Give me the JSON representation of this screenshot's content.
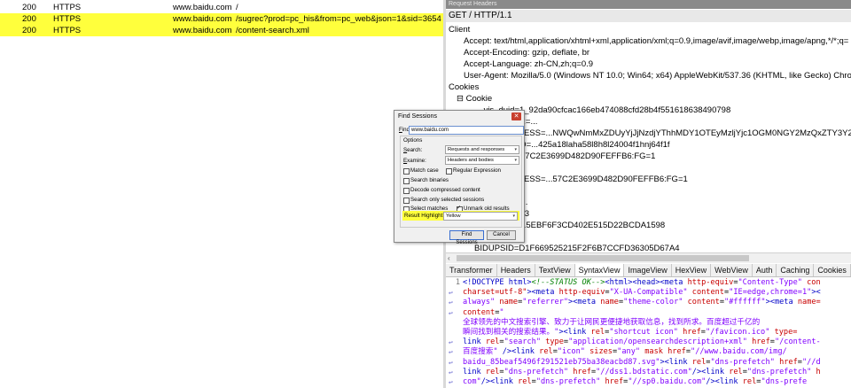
{
  "sessions": [
    {
      "result": "200",
      "protocol": "HTTPS",
      "host": "www.baidu.com",
      "url": "/",
      "highlight": false
    },
    {
      "result": "200",
      "protocol": "HTTPS",
      "host": "www.baidu.com",
      "url": "/sugrec?prod=pc_his&from=pc_web&json=1&sid=3654",
      "highlight": true
    },
    {
      "result": "200",
      "protocol": "HTTPS",
      "host": "www.baidu.com",
      "url": "/content-search.xml",
      "highlight": true
    }
  ],
  "inspector": {
    "caption": "Request Headers",
    "request_line": "GET / HTTP/1.1",
    "headers": [
      {
        "cls": "g",
        "text": "Client"
      },
      {
        "cls": "h2",
        "text": "Accept: text/html,application/xhtml+xml,application/xml;q=0.9,image/avif,image/webp,image/apng,*/*;q="
      },
      {
        "cls": "h2",
        "text": "Accept-Encoding: gzip, deflate, br"
      },
      {
        "cls": "h2",
        "text": "Accept-Language: zh-CN,zh;q=0.9"
      },
      {
        "cls": "h2",
        "text": "User-Agent: Mozilla/5.0 (Windows NT 10.0; Win64; x64) AppleWebKit/537.36 (KHTML, like Gecko) Chrome/"
      },
      {
        "cls": "g",
        "text": "Cookies"
      },
      {
        "cls": "h1",
        "text": "⊟ Cookie"
      },
      {
        "cls": "h3",
        "text": "__yjs_duid=1_92da90cfcac166eb474088cfd28b4f551618638490798"
      },
      {
        "cls": "h3",
        "text": "BA_HECTOR=..."
      },
      {
        "cls": "h3",
        "text": "BAIDUID_BFESS=...NWQwNmMxZDUyYjJjNzdjYThhMDY1OTEyMzljYjc1OGM0NGY2MzQxZTY3Y2UzZmY4NTlmN"
      },
      {
        "cls": "h3",
        "text": "H_PS_PSSID=...425a18laha58l8h8l24004f1hnj64f1f"
      },
      {
        "cls": "h3",
        "text": "BAIDUID=...57C2E3699D482D90FEFFB6:FG=1"
      },
      {
        "cls": "h3",
        "text": "BDORZ=...5"
      },
      {
        "cls": "h3",
        "text": "BAIDUID_BFESS=...57C2E3699D482D90FEFFB6:FG=1"
      },
      {
        "cls": "h3",
        "text": "BD_UPN=..."
      },
      {
        "cls": "h3",
        "text": "BD_HOME=..."
      },
      {
        "cls": "h3",
        "text": "delPer=...4753"
      },
      {
        "cls": "h3",
        "text": "BIDUPSID=...5EBF6F3CD402E515D22BCDA1598"
      },
      {
        "cls": "h3",
        "text": "BDSVRTM=0"
      },
      {
        "cls": "h3",
        "text": "BIDUPSID=D1F669525215F2F6B7CCFD36305D67A4"
      }
    ],
    "tabs": [
      "Transformer",
      "Headers",
      "TextView",
      "SyntaxView",
      "ImageView",
      "HexView",
      "WebView",
      "Auth",
      "Caching",
      "Cookies",
      "Raw"
    ],
    "active_tab": "SyntaxView",
    "code_lines": [
      {
        "n": "1",
        "g": "",
        "html": "<span class='tag'>&lt;!DOCTYPE html&gt;</span><span class='cmt'>&lt;!--STATUS OK--&gt;</span><span class='tag'>&lt;html&gt;&lt;head&gt;&lt;meta</span> <span class='attr'>http-equiv</span>=<span class='val'>\"Content-Type\"</span> <span class='attr'>con</span>"
      },
      {
        "n": "",
        "g": "↩",
        "html": "<span class='attr'>charset=utf-8\"</span><span class='tag'>&gt;&lt;meta</span> <span class='attr'>http-equiv</span>=<span class='val'>\"X-UA-Compatible\"</span> <span class='attr'>content</span>=<span class='val'>\"IE=edge,chrome=1\"</span><span class='tag'>&gt;&lt;</span>"
      },
      {
        "n": "",
        "g": "↩",
        "html": "<span class='val'>always\"</span> <span class='attr'>name</span>=<span class='val'>\"referrer\"</span><span class='tag'>&gt;&lt;meta</span> <span class='attr'>name</span>=<span class='val'>\"theme-color\"</span> <span class='attr'>content</span>=<span class='val'>\"#ffffff\"</span><span class='tag'>&gt;&lt;meta</span> <span class='attr'>name=</span>"
      },
      {
        "n": "",
        "g": "↩",
        "html": "<span class='attr'>content</span>=<span class='val'>\"</span>"
      },
      {
        "n": "",
        "g": "",
        "html": "<span class='val'>全球领先的中文搜索引擎、致力于让网民更便捷地获取信息，找到所求。百度超过千亿的</span>"
      },
      {
        "n": "",
        "g": "",
        "html": "<span class='val'>瞬间找到相关的搜索结果。\"</span><span class='tag'>&gt;&lt;link</span> <span class='attr'>rel</span>=<span class='val'>\"shortcut icon\"</span> <span class='attr'>href</span>=<span class='val'>\"/favicon.ico\"</span> <span class='attr'>type=</span>"
      },
      {
        "n": "",
        "g": "↩",
        "html": "<span class='tag'>link</span> <span class='attr'>rel</span>=<span class='val'>\"search\"</span> <span class='attr'>type</span>=<span class='val'>\"application/opensearchdescription+xml\"</span> <span class='attr'>href</span>=<span class='val'>\"/content-</span>"
      },
      {
        "n": "",
        "g": "↩",
        "html": "<span class='val'>百度搜索\"</span> <span class='tag'>/&gt;&lt;link</span> <span class='attr'>rel</span>=<span class='val'>\"icon\"</span> <span class='attr'>sizes</span>=<span class='val'>\"any\"</span> <span class='attr'>mask</span> <span class='attr'>href</span>=<span class='val'>\"//www.baidu.com/img/</span>"
      },
      {
        "n": "",
        "g": "↩",
        "html": "<span class='val'>baidu_85beaf5496f291521eb75ba38eacbd87.svg\"</span><span class='tag'>&gt;&lt;link</span> <span class='attr'>rel</span>=<span class='val'>\"dns-prefetch\"</span> <span class='attr'>href</span>=<span class='val'>\"//d</span>"
      },
      {
        "n": "",
        "g": "↩",
        "html": "<span class='tag'>link</span> <span class='attr'>rel</span>=<span class='val'>\"dns-prefetch\"</span> <span class='attr'>href</span>=<span class='val'>\"//dss1.bdstatic.com\"</span><span class='tag'>/&gt;&lt;link</span> <span class='attr'>rel</span>=<span class='val'>\"dns-prefetch\"</span> <span class='attr'>h</span>"
      },
      {
        "n": "",
        "g": "↩",
        "html": "<span class='val'>com\"</span><span class='tag'>/&gt;&lt;link</span> <span class='attr'>rel</span>=<span class='val'>\"dns-prefetch\"</span> <span class='attr'>href</span>=<span class='val'>\"//sp0.baidu.com\"</span><span class='tag'>/&gt;&lt;link</span> <span class='attr'>rel</span>=<span class='val'>\"dns-prefe</span>"
      }
    ]
  },
  "dialog": {
    "title": "Find Sessions",
    "close_glyph": "✕",
    "find_label_u": "F",
    "find_label_rest": "ind:",
    "find_value": "www.baidu.com",
    "options_label": "Options",
    "search_label_u": "S",
    "search_label_rest": "earch:",
    "search_value": "Requests and responses",
    "examine_label_u": "E",
    "examine_label_rest": "xamine:",
    "examine_value": "Headers and bodies",
    "match_case": "Match case",
    "regex": "Regular Expression",
    "search_binaries": "Search binaries",
    "decode": "Decode compressed content",
    "only_selected": "Search only selected sessions",
    "select_matches": "Select matches",
    "unmark": "Unmark old results",
    "highlight_label": "Result Highlight:",
    "highlight_value": "Yellow",
    "find_button": "Find Sessions",
    "cancel_button": "Cancel"
  },
  "colors": {
    "highlight": "#ffff3c",
    "dialog_close": "#c8402e"
  }
}
